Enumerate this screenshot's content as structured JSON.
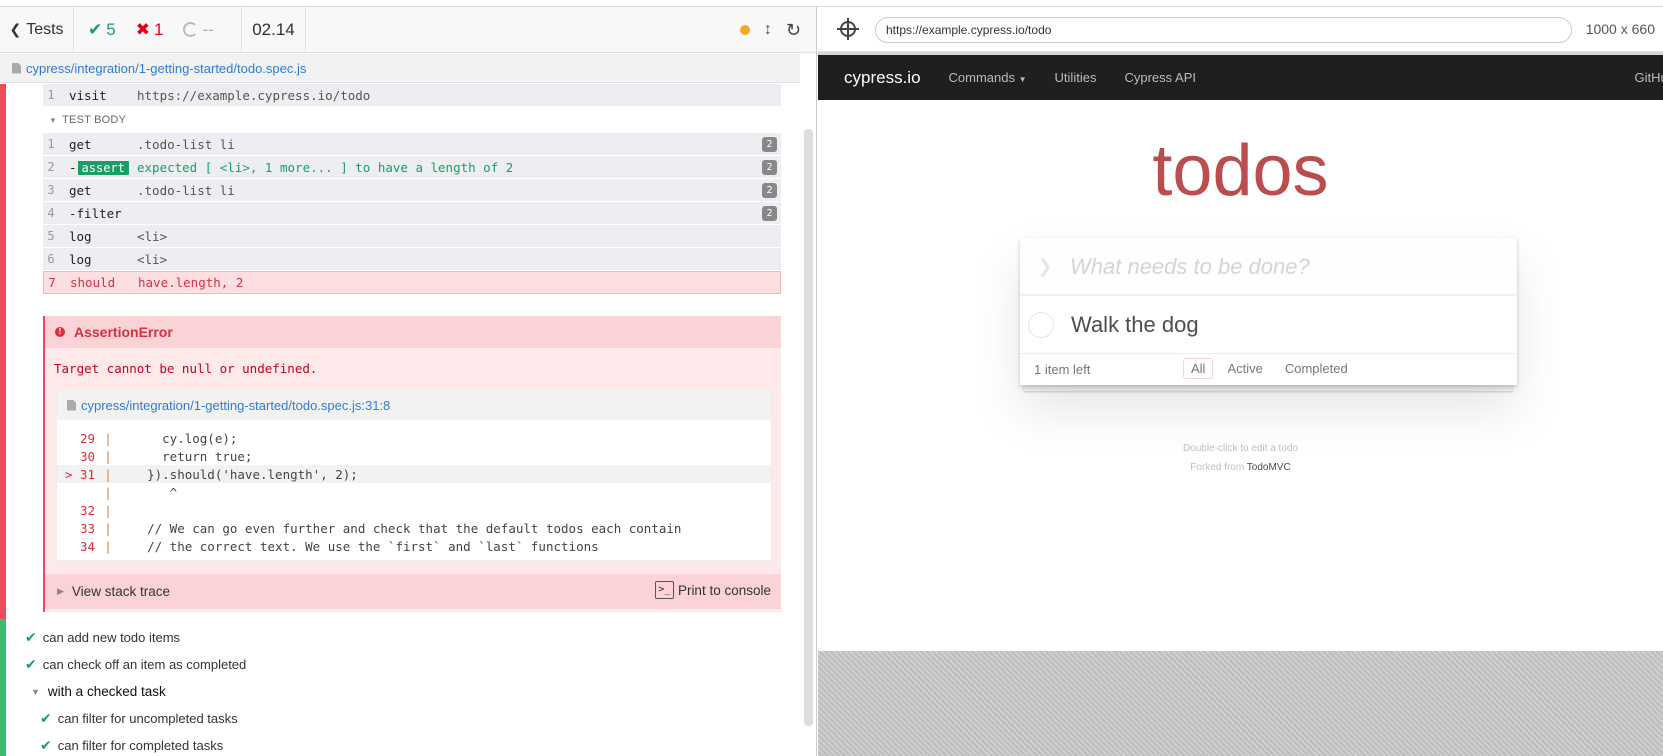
{
  "header": {
    "tests_label": "Tests",
    "passed": "5",
    "failed": "1",
    "pending": "--",
    "duration": "02.14"
  },
  "spec": {
    "path": "cypress/integration/1-getting-started/todo.spec.js"
  },
  "before_each": {
    "rows": [
      {
        "num": "1",
        "name": "visit",
        "message": "https://example.cypress.io/todo"
      }
    ]
  },
  "test_body": {
    "heading": "TEST BODY",
    "rows": [
      {
        "num": "1",
        "name": "get",
        "message": ".todo-list li",
        "badge": "2"
      },
      {
        "num": "2",
        "name": "-",
        "pill": "assert",
        "message": "expected [ <li>, 1 more... ] to have a length of 2",
        "badge": "2"
      },
      {
        "num": "3",
        "name": "get",
        "message": ".todo-list li",
        "badge": "2"
      },
      {
        "num": "4",
        "name": "-filter",
        "message": "",
        "badge": "2"
      },
      {
        "num": "5",
        "name": "log",
        "message": "<li>"
      },
      {
        "num": "6",
        "name": "log",
        "message": "<li>"
      },
      {
        "num": "7",
        "name": "should",
        "message": "have.length, 2"
      }
    ]
  },
  "error": {
    "title": "AssertionError",
    "message": "Target cannot be null or undefined.",
    "code_file": "cypress/integration/1-getting-started/todo.spec.js:31:8",
    "code_lines": [
      {
        "ln": "29",
        "code": "      cy.log(e);"
      },
      {
        "ln": "30",
        "code": "      return true;"
      },
      {
        "ln": "> 31",
        "code": "    }).should('have.length', 2);"
      },
      {
        "ln": "",
        "code": "       ^"
      },
      {
        "ln": "32",
        "code": ""
      },
      {
        "ln": "33",
        "code": "    // We can go even further and check that the default todos each contain"
      },
      {
        "ln": "34",
        "code": "    // the correct text. We use the `first` and `last` functions"
      }
    ],
    "stack_label": "View stack trace",
    "print_label": "Print to console",
    "print_icon": ">_"
  },
  "tests": {
    "items": [
      {
        "label": "can add new todo items"
      },
      {
        "label": "can check off an item as completed"
      }
    ],
    "suite": "with a checked task",
    "suite_items": [
      {
        "label": "can filter for uncompleted tasks"
      },
      {
        "label": "can filter for completed tasks"
      }
    ]
  },
  "browser": {
    "url": "https://example.cypress.io/todo",
    "viewport": "1000 x 660"
  },
  "app": {
    "brand": "cypress.io",
    "nav": [
      "Commands",
      "Utilities",
      "Cypress API"
    ],
    "nav_right": "GitHub",
    "title": "todos",
    "placeholder": "What needs to be done?",
    "todo": "Walk the dog",
    "items_left": "1 item left",
    "filters": [
      "All",
      "Active",
      "Completed"
    ],
    "info_line1": "Double-click to edit a todo",
    "info_forked": "Forked from",
    "info_link": "TodoMVC"
  },
  "colors": {
    "pass": "#1b9e64",
    "fail": "#e3001b",
    "accent": "#af2f2f"
  }
}
